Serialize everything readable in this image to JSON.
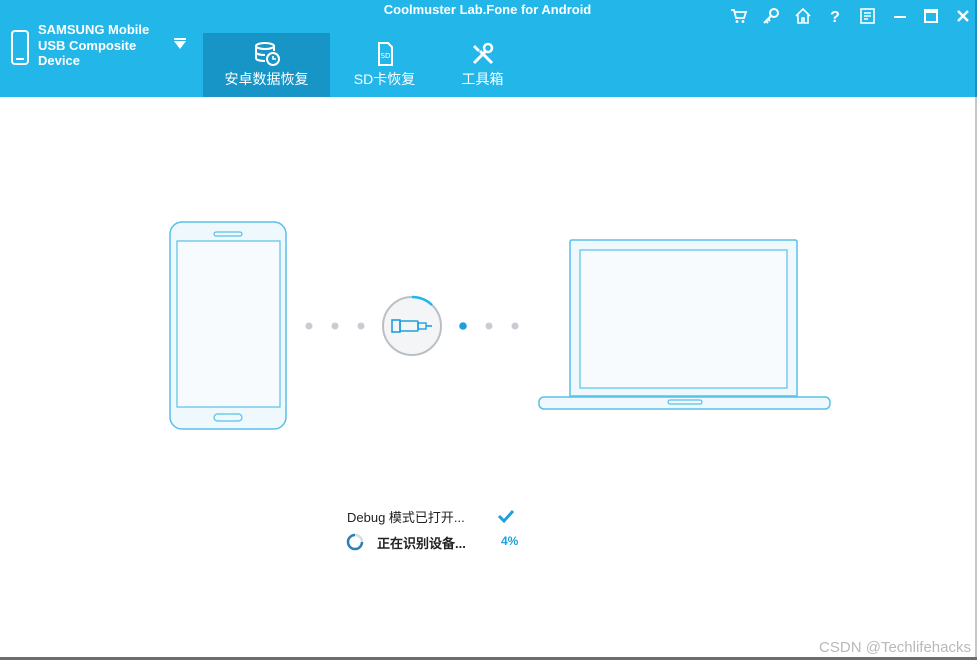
{
  "window": {
    "title": "Coolmuster Lab.Fone for Android"
  },
  "device": {
    "name_line1": "SAMSUNG Mobile",
    "name_line2": "USB Composite",
    "name_line3": "Device"
  },
  "tabs": [
    {
      "label": "安卓数据恢复",
      "icon": "database-clock-icon",
      "active": true
    },
    {
      "label": "SD卡恢复",
      "icon": "sd-card-icon",
      "active": false
    },
    {
      "label": "工具箱",
      "icon": "tools-icon",
      "active": false
    }
  ],
  "toolbar": [
    "cart-icon",
    "key-icon",
    "home-icon",
    "help-icon",
    "feedback-icon",
    "minimize-icon",
    "maximize-icon",
    "close-icon"
  ],
  "status": {
    "debug_text": "Debug 模式已打开...",
    "identifying_text": "正在识别设备...",
    "progress_text": "4%"
  },
  "watermark": "CSDN @Techlifehacks",
  "colors": {
    "header": "#22b6e9",
    "active_tab": "#1895c7",
    "accent": "#1ea0dc",
    "device_stroke": "#58c1e8"
  }
}
